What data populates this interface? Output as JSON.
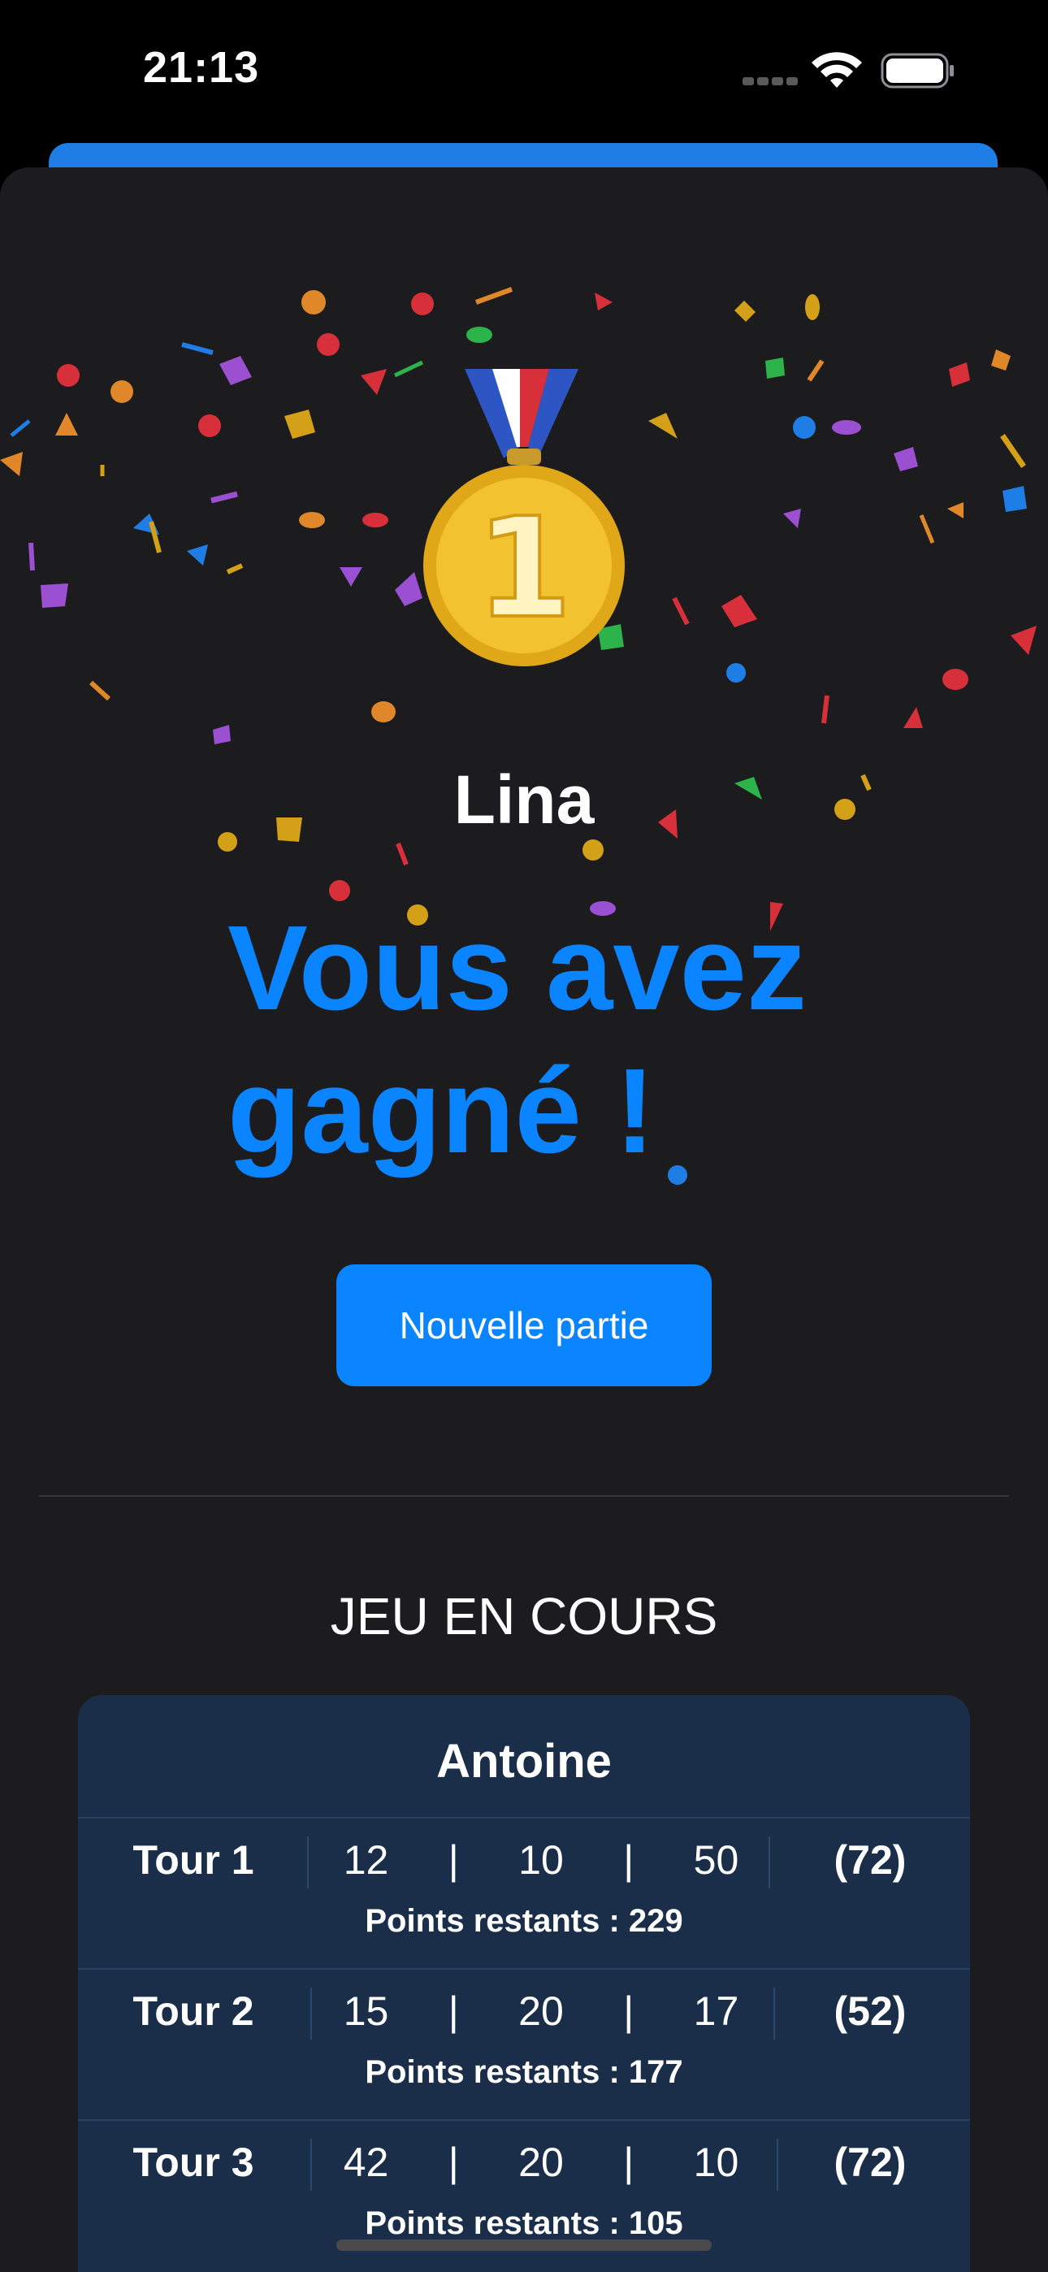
{
  "status": {
    "time": "21:13"
  },
  "result": {
    "winner": "Lina",
    "message": "Vous avez gagné !",
    "new_game_label": "Nouvelle partie"
  },
  "game": {
    "section_title": "JEU EN COURS",
    "player": "Antoine",
    "rounds": [
      {
        "label": "Tour 1",
        "throws": [
          "12",
          "10",
          "50"
        ],
        "total": "(72)",
        "remaining": "Points restants : 229"
      },
      {
        "label": "Tour 2",
        "throws": [
          "15",
          "20",
          "17"
        ],
        "total": "(52)",
        "remaining": "Points restants : 177"
      },
      {
        "label": "Tour 3",
        "throws": [
          "42",
          "20",
          "10"
        ],
        "total": "(72)",
        "remaining": "Points restants : 105"
      }
    ]
  },
  "colors": {
    "accent": "#0a84ff",
    "sheet": "#1c1c1e",
    "card": "#1a2e4a"
  }
}
